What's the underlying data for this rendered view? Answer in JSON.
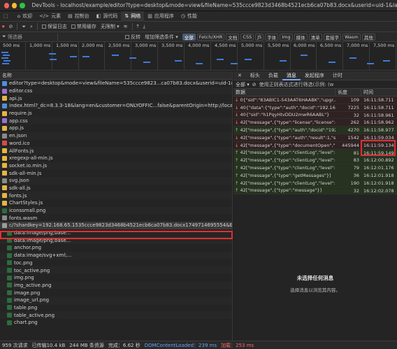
{
  "window": {
    "title": "DevTools - localhost/example/editor?type=desktop&mode=view&fileName=535ccce9823d3468b4521ecb6ca07b83.docx&userid=uid-1&lang=en&direct..."
  },
  "tabs": [
    {
      "icon": "⬚",
      "label": ""
    },
    {
      "icon": "⌂",
      "label": "欢迎"
    },
    {
      "icon": "</>",
      "label": "元素"
    },
    {
      "icon": "▤",
      "label": "控制台"
    },
    {
      "icon": "◧",
      "label": "源代码"
    },
    {
      "icon": "⇅",
      "label": "网络"
    },
    {
      "icon": "▥",
      "label": "应用程序"
    },
    {
      "icon": "◷",
      "label": "性能"
    }
  ],
  "toolbar": {
    "preserve_log": "保留日志",
    "disable_cache": "禁用缓存",
    "throttle": "无限制"
  },
  "filter": {
    "placeholder": "筛选器",
    "invert": "反转",
    "more_filters": "增加筛选条件",
    "types": [
      "全部",
      "Fetch/XHR",
      "文档",
      "CSS",
      "JS",
      "字体",
      "Img",
      "媒体",
      "清单",
      "套接字",
      "Wasm",
      "其他"
    ]
  },
  "timeline": {
    "ticks": [
      "500 ms",
      "1,000 ms",
      "1,500 ms",
      "2,000 ms",
      "2,500 ms",
      "3,000 ms",
      "3,500 ms",
      "4,000 ms",
      "4,500 ms",
      "5,000 ms",
      "5,500 ms",
      "6,000 ms",
      "6,500 ms",
      "7,000 ms",
      "7,500 ms"
    ]
  },
  "requests": {
    "header": "名称",
    "items": [
      {
        "name": "editor?type=desktop&mode=view&fileName=535ccce9823...ca07b83.docx&userid=uid-1&lang=en&d...",
        "color": "#4d8fe0"
      },
      {
        "name": "editor.css",
        "color": "#9a6fd6"
      },
      {
        "name": "api.js",
        "color": "#e5b543"
      },
      {
        "name": "index.html?_dc=8.3.3-18&lang=en&customer=ONLYOFFIC...false&parentOrigin=http://localhost&fileT...",
        "color": "#4d8fe0"
      },
      {
        "name": "require.js",
        "color": "#e5b543"
      },
      {
        "name": "app.css",
        "color": "#9a6fd6"
      },
      {
        "name": "app.js",
        "color": "#e5b543"
      },
      {
        "name": "en.json",
        "color": "#8a8a8a"
      },
      {
        "name": "word.ico",
        "color": "#d64b4b"
      },
      {
        "name": "AllFonts.js",
        "color": "#e5b543"
      },
      {
        "name": "xregexp-all-min.js",
        "color": "#e5b543"
      },
      {
        "name": "socket.io.min.js",
        "color": "#e5b543"
      },
      {
        "name": "sdk-all-min.js",
        "color": "#e5b543"
      },
      {
        "name": "svg.json",
        "color": "#8a8a8a"
      },
      {
        "name": "sdk-all.js",
        "color": "#e5b543"
      },
      {
        "name": "fonts.js",
        "color": "#e5b543"
      },
      {
        "name": "ChartStyles.js",
        "color": "#e5b543"
      },
      {
        "name": "iconssmall.png",
        "color": "#2e6b3e"
      },
      {
        "name": "fonts.wasm",
        "color": "#8a8a8a"
      },
      {
        "name": "c/?shardkey=192.168.65.1535ccce9823d3468b4521ecb6ca07b83.docx1749714695554&EIO=4&tran...",
        "color": "#9b9b9b"
      },
      {
        "name": "data:image/png;base...",
        "color": "#2e6b3e"
      },
      {
        "name": "data:image/png;base...",
        "color": "#2e6b3e"
      },
      {
        "name": "anchor.png",
        "color": "#2e6b3e"
      },
      {
        "name": "data:image/svg+xml;...",
        "color": "#2e6b3e"
      },
      {
        "name": "toc.png",
        "color": "#2e6b3e"
      },
      {
        "name": "toc_active.png",
        "color": "#2e6b3e"
      },
      {
        "name": "img.png",
        "color": "#2e6b3e"
      },
      {
        "name": "img_active.png",
        "color": "#2e6b3e"
      },
      {
        "name": "image.png",
        "color": "#2e6b3e"
      },
      {
        "name": "image_url.png",
        "color": "#2e6b3e"
      },
      {
        "name": "table.png",
        "color": "#2e6b3e"
      },
      {
        "name": "table_active.png",
        "color": "#2e6b3e"
      },
      {
        "name": "chart.png",
        "color": "#2e6b3e"
      }
    ]
  },
  "detail": {
    "tabs": [
      "标头",
      "负载",
      "消息",
      "发起程序",
      "计时"
    ],
    "filter_all": "全部",
    "regex_label": "使用正则表达式进行筛选(示例: (w",
    "columns": {
      "data": "数据",
      "length": "长度",
      "time": "时间"
    },
    "messages": [
      {
        "dir": "down",
        "data": "0{\"sid\":\"83ABlC1-543AAT6HAABK\",\"upgr...",
        "length": "109",
        "time": "16:11:58.711"
      },
      {
        "dir": "down",
        "data": "40{\"data\":{\"type\":\"auth\",\"docid\":\"192.168...",
        "length": "7225",
        "time": "16:11:58.711"
      },
      {
        "dir": "down",
        "data": "40{\"sid\":\"h1PqyHtvDDU2mwR6AABL\"}",
        "length": "32",
        "time": "16:11:58.961"
      },
      {
        "dir": "down",
        "data": "42[\"message\",{\"type\":\"license\",\"license\":...",
        "length": "262",
        "time": "16:11:58.962"
      },
      {
        "dir": "up",
        "data": "42[\"message\",{\"type\":\"auth\",\"docid\":\"192...",
        "length": "4270",
        "time": "16:11:58.977"
      },
      {
        "dir": "down",
        "data": "42[\"message\",{\"type\":\"auth\",\"result\":1,\"s...",
        "length": "1542",
        "time": "16:11:59.034"
      },
      {
        "dir": "down",
        "data": "42[\"message\",{\"type\":\"documentOpen\",\"...",
        "length": "445944",
        "time": "16:11:59.134"
      },
      {
        "dir": "up",
        "data": "42[\"message\",{\"type\":\"clientLog\",\"level\":...",
        "length": "81",
        "time": "16:11:59.149"
      },
      {
        "dir": "up",
        "data": "42[\"message\",{\"type\":\"clientLog\",\"level\":...",
        "length": "83",
        "time": "16:12:00.892"
      },
      {
        "dir": "up",
        "data": "42[\"message\",{\"type\":\"clientLog\",\"level\":...",
        "length": "79",
        "time": "16:12:01.176"
      },
      {
        "dir": "up",
        "data": "42[\"message\",{\"type\":\"getMessages\"}]",
        "length": "36",
        "time": "16:12:01.918"
      },
      {
        "dir": "up",
        "data": "42[\"message\",{\"type\":\"clientLog\",\"level\":...",
        "length": "190",
        "time": "16:12:01.918"
      },
      {
        "dir": "up",
        "data": "42[\"message\",{\"type\":\"message\"}]",
        "length": "32",
        "time": "16:12:02.078"
      }
    ],
    "empty_title": "未选择任何消息",
    "empty_sub": "选择消息以浏览其内容。"
  },
  "status": {
    "requests": "959 次请求",
    "transferred": "已传输10.4 kB",
    "resources": "244 MB 条资源",
    "finish": "完成：6.62 秒",
    "dcl": "DOMContentLoaded：239 ms",
    "load": "加载：253 ms"
  },
  "colors": {
    "highlight": "#e03030",
    "accent": "#7aa7ff",
    "dcl": "#6aa0ff",
    "load": "#ff6b6b"
  }
}
